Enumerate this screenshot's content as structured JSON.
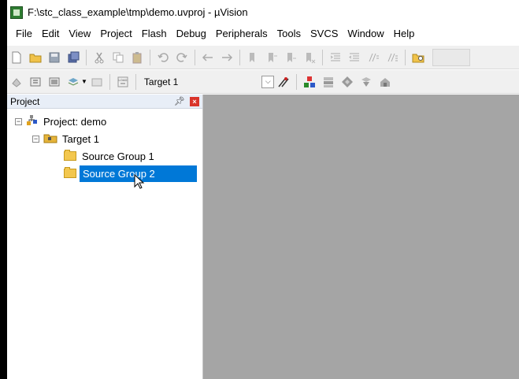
{
  "window": {
    "title": "F:\\stc_class_example\\tmp\\demo.uvproj - µVision"
  },
  "menubar": {
    "items": [
      "File",
      "Edit",
      "View",
      "Project",
      "Flash",
      "Debug",
      "Peripherals",
      "Tools",
      "SVCS",
      "Window",
      "Help"
    ]
  },
  "toolbar2": {
    "target": "Target 1"
  },
  "project_panel": {
    "title": "Project",
    "tree": {
      "project": "Project: demo",
      "target": "Target 1",
      "groups": [
        "Source Group 1",
        "Source Group 2"
      ]
    }
  },
  "colors": {
    "selection": "#0078d7",
    "editor_bg": "#a5a5a5"
  }
}
